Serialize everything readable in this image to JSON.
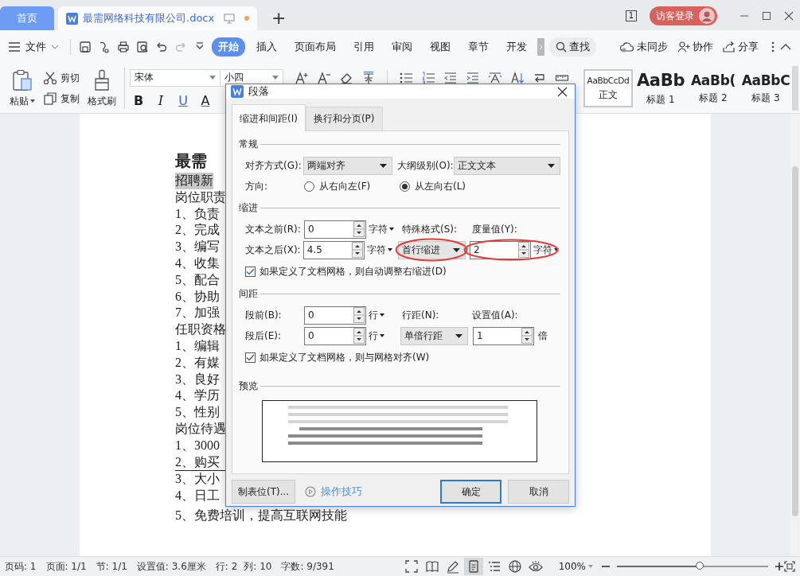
{
  "tabs": [
    {
      "label": "首页",
      "kind": "home",
      "selected": false
    },
    {
      "label": "最需网络科技有限公司.docx",
      "kind": "document",
      "selected": true,
      "modified": true
    }
  ],
  "new_tab": "+",
  "window_count": "1",
  "login": "访客登录",
  "menu": {
    "file": "文件",
    "tabs": [
      {
        "label": "开始",
        "selected": true
      },
      {
        "label": "插入",
        "selected": false
      },
      {
        "label": "页面布局",
        "selected": false
      },
      {
        "label": "引用",
        "selected": false
      },
      {
        "label": "审阅",
        "selected": false
      },
      {
        "label": "视图",
        "selected": false
      },
      {
        "label": "章节",
        "selected": false
      },
      {
        "label": "开发",
        "selected": false
      }
    ],
    "search": "查找",
    "actions": [
      "未同步",
      "协作",
      "分享"
    ]
  },
  "ribbon": {
    "paste": "粘贴",
    "cut": "剪切",
    "copy": "复制",
    "painter": "格式刷",
    "font": "宋体",
    "size": "小四",
    "format_buttons": [
      "B",
      "I",
      "U",
      "A"
    ],
    "styles": [
      {
        "preview": "AaBbCcDd",
        "label": "正文",
        "selected": true,
        "kind": "body"
      },
      {
        "preview": "AaBb",
        "label": "标题 1",
        "selected": false,
        "kind": "h1"
      },
      {
        "preview": "AaBb(",
        "label": "标题 2",
        "selected": false,
        "kind": "h2"
      },
      {
        "preview": "AaBbC",
        "label": "标题 3",
        "selected": false,
        "kind": "h3"
      }
    ]
  },
  "document": {
    "lines": [
      {
        "text": "最需",
        "kind": "title",
        "highlighted": false,
        "underlined": false
      },
      {
        "text": "招聘新",
        "kind": "text",
        "highlighted": true,
        "underlined": false
      },
      {
        "text": "岗位职责",
        "kind": "text",
        "highlighted": false,
        "underlined": false
      },
      {
        "text": "1、负责",
        "kind": "text",
        "highlighted": false,
        "underlined": false
      },
      {
        "text": "2、完成",
        "kind": "text",
        "highlighted": false,
        "underlined": false
      },
      {
        "text": "3、编写",
        "kind": "text",
        "highlighted": false,
        "underlined": false
      },
      {
        "text": "4、收集",
        "kind": "text",
        "highlighted": false,
        "underlined": false
      },
      {
        "text": "5、配合",
        "kind": "text",
        "highlighted": false,
        "underlined": false
      },
      {
        "text": "6、协助",
        "kind": "text",
        "highlighted": false,
        "underlined": false
      },
      {
        "text": "7、加强",
        "kind": "text",
        "highlighted": false,
        "underlined": false
      },
      {
        "text": "任职资格",
        "kind": "text",
        "highlighted": false,
        "underlined": false
      },
      {
        "text": "1、编辑",
        "kind": "text",
        "highlighted": false,
        "underlined": false
      },
      {
        "text": "2、有媒",
        "kind": "text",
        "highlighted": false,
        "underlined": false
      },
      {
        "text": "3、良好",
        "kind": "text",
        "highlighted": false,
        "underlined": false
      },
      {
        "text": "4、学历",
        "kind": "text",
        "highlighted": false,
        "underlined": false
      },
      {
        "text": "5、性别",
        "kind": "text",
        "highlighted": false,
        "underlined": false
      },
      {
        "text": "岗位待遇",
        "kind": "text",
        "highlighted": false,
        "underlined": false
      },
      {
        "text": "1、3000",
        "kind": "text",
        "highlighted": false,
        "underlined": false
      },
      {
        "text": "2、购买",
        "kind": "text",
        "highlighted": false,
        "underlined": true
      },
      {
        "text": "3、大小",
        "kind": "text",
        "highlighted": false,
        "underlined": false
      },
      {
        "text": "4、日工",
        "kind": "text",
        "highlighted": false,
        "underlined": false
      },
      {
        "text": "5、免费培训，提高互联网技能",
        "kind": "text",
        "highlighted": false,
        "underlined": false
      }
    ]
  },
  "dialog": {
    "title": "段落",
    "tabs": [
      {
        "label": "缩进和间距(I)",
        "selected": true
      },
      {
        "label": "换行和分页(P)",
        "selected": false
      }
    ],
    "general": {
      "heading": "常规",
      "align_label": "对齐方式(G):",
      "align": "两端对齐",
      "outline_label": "大纲级别(O):",
      "outline": "正文文本",
      "direction_label": "方向:",
      "directions": [
        {
          "label": "从右向左(F)",
          "selected": false
        },
        {
          "label": "从左向右(L)",
          "selected": true
        }
      ]
    },
    "indent": {
      "heading": "缩进",
      "before_label": "文本之前(R):",
      "before": "0",
      "before_unit": "字符",
      "after_label": "文本之后(X):",
      "after": "4.5",
      "after_unit": "字符",
      "special_label": "特殊格式(S):",
      "special": "首行缩进",
      "special_circled": true,
      "measure_label": "度量值(Y):",
      "measure": "2",
      "measure_unit": "字符",
      "measure_circled": true,
      "grid_check": {
        "label": "如果定义了文档网格，则自动调整右缩进(D)",
        "checked": true
      }
    },
    "spacing": {
      "heading": "间距",
      "before_label": "段前(B):",
      "before": "0",
      "before_unit": "行",
      "after_label": "段后(E):",
      "after": "0",
      "after_unit": "行",
      "line_label": "行距(N):",
      "line": "单倍行距",
      "value_label": "设置值(A):",
      "value": "1",
      "value_unit": "倍",
      "grid_check": {
        "label": "如果定义了文档网格，则与网格对齐(W)",
        "checked": true
      }
    },
    "preview_heading": "预览",
    "tabs_button": "制表位(T)...",
    "tips_link": "操作技巧",
    "ok": "确定",
    "cancel": "取消"
  },
  "status_bar": {
    "items": [
      "页码: 1",
      "页面: 1/1",
      "节: 1/1",
      "设置值: 3.6厘米",
      "行: 2",
      "列: 10",
      "字数: 9/391"
    ],
    "zoom": "100%",
    "zoom_slider": {
      "level": 0.55
    }
  }
}
